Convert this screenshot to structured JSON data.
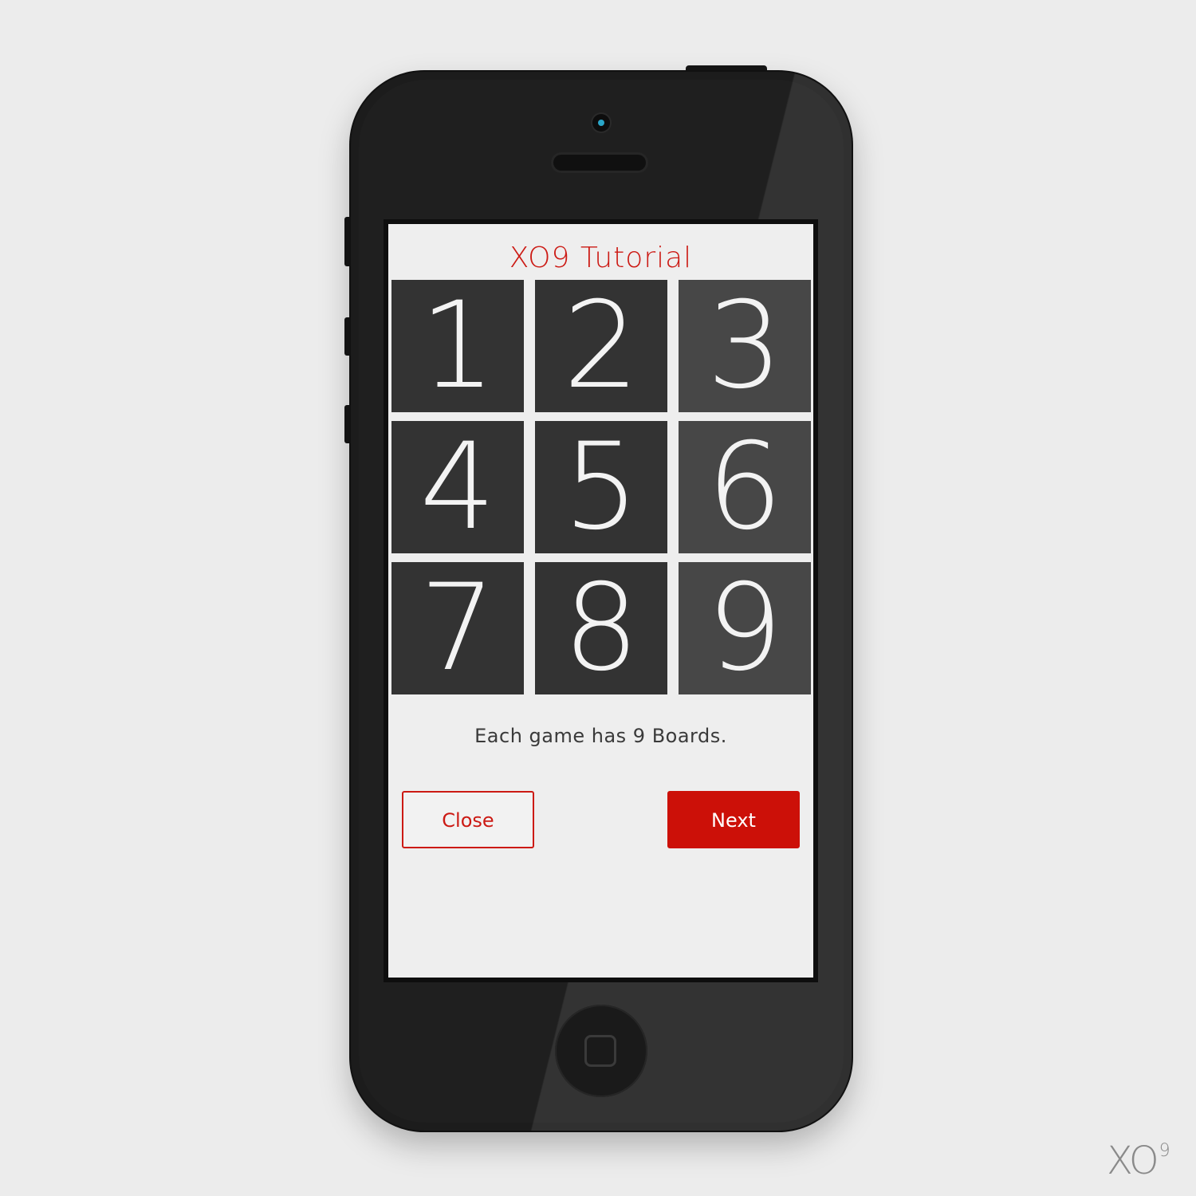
{
  "app": {
    "title": "XO9 Tutorial"
  },
  "board": {
    "cells": [
      "1",
      "2",
      "3",
      "4",
      "5",
      "6",
      "7",
      "8",
      "9"
    ]
  },
  "tutorial": {
    "message": "Each game has 9 Boards."
  },
  "buttons": {
    "close_label": "Close",
    "next_label": "Next"
  },
  "watermark": {
    "text": "XO",
    "superscript": "9"
  },
  "colors": {
    "accent": "#cc1008",
    "cell_dark": "#333333",
    "cell_light": "#474747",
    "screen_bg": "#eeeeee",
    "phone_body": "#1c1c1c"
  },
  "icons": {
    "camera": "camera-icon",
    "speaker": "speaker-icon",
    "home": "home-button-icon"
  }
}
